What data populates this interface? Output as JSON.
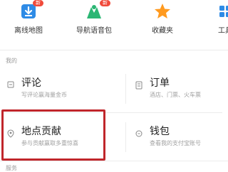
{
  "toolbar": {
    "items": [
      {
        "label": "离线地图",
        "icon": "download-icon",
        "badge": "新"
      },
      {
        "label": "导航语音包",
        "icon": "voice-pack-icon",
        "badge": "新"
      },
      {
        "label": "收藏夹",
        "icon": "star-icon"
      },
      {
        "label": "工具",
        "icon": "tool-icon"
      }
    ]
  },
  "sections": {
    "mine_title": "我的",
    "bottom_title": "服务"
  },
  "grid": [
    {
      "title": "评论",
      "subtitle": "写评论赢海量金币",
      "icon": "comment-icon"
    },
    {
      "title": "订单",
      "subtitle": "酒店、门票、火车票",
      "icon": "order-icon"
    },
    {
      "title": "地点贡献",
      "subtitle": "参与贡献赢取多重惊喜",
      "icon": "location-pin-icon"
    },
    {
      "title": "钱包",
      "subtitle": "查看我的支付宝账号",
      "icon": "wallet-icon"
    }
  ],
  "colors": {
    "accent_blue": "#2e8be6",
    "accent_green": "#2bb673",
    "accent_orange": "#ff9a1f",
    "badge_red": "#f04a3a",
    "highlight_red": "#c0262b"
  }
}
